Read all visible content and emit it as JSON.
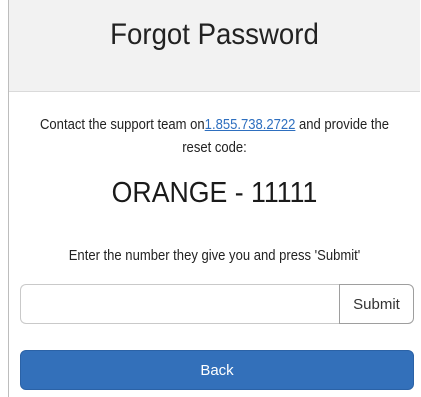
{
  "header": {
    "title": "Forgot Password"
  },
  "instructions": {
    "before_link": "Contact the support team on",
    "phone_link": "1.855.738.2722",
    "after_link": " and provide the reset code:"
  },
  "reset_code": {
    "prefix": "ORANGE",
    "separator": " - ",
    "number": "11111"
  },
  "prompt": {
    "text": "Enter the number they give you and press 'Submit'"
  },
  "code_input": {
    "value": "",
    "placeholder": ""
  },
  "buttons": {
    "submit_label": "Submit",
    "back_label": "Back"
  },
  "colors": {
    "link": "#2e6fbf",
    "primary_button": "#3370ba",
    "header_background": "#f2f2f2"
  }
}
